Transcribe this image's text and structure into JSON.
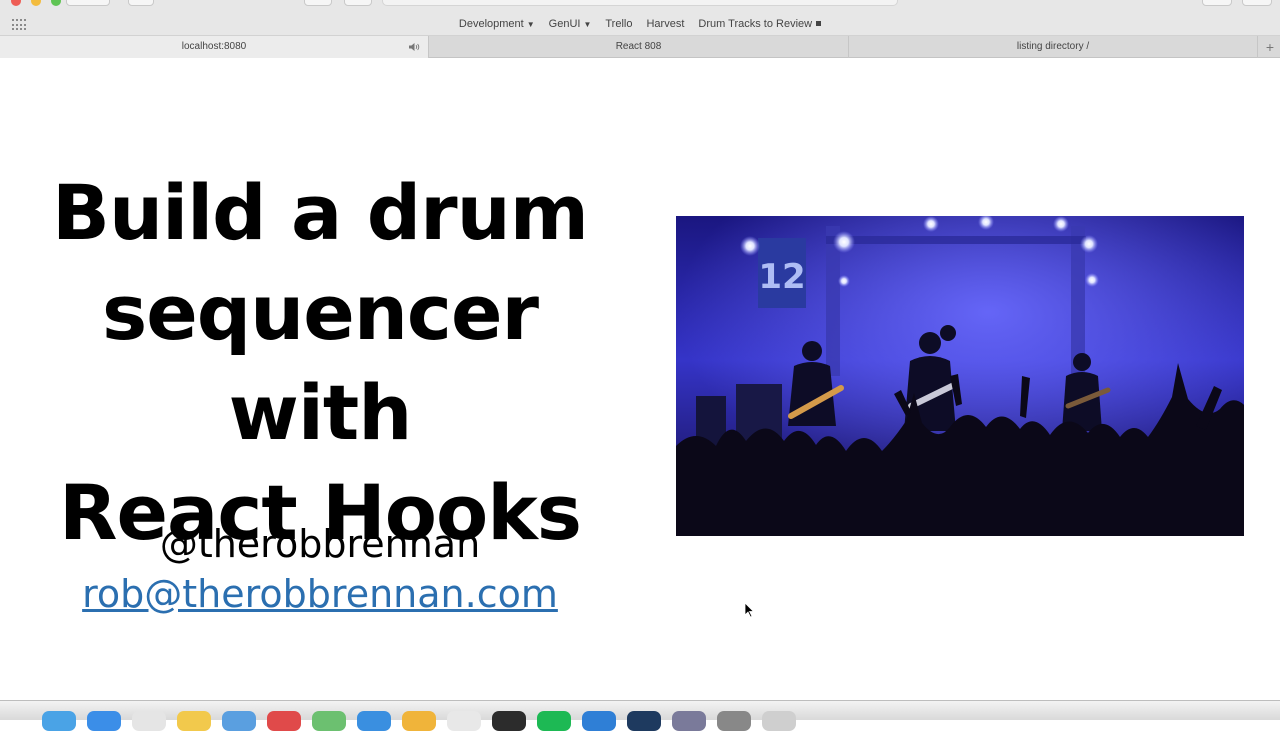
{
  "browser": {
    "url": "localhost",
    "favorites": [
      {
        "label": "Development",
        "dropdown": true
      },
      {
        "label": "GenUI",
        "dropdown": true
      },
      {
        "label": "Trello",
        "dropdown": false
      },
      {
        "label": "Harvest",
        "dropdown": false
      },
      {
        "label": "Drum Tracks to Review",
        "dropdown": false
      }
    ],
    "tabs": [
      {
        "label": "localhost:8080",
        "audio": true,
        "active": true
      },
      {
        "label": "React 808",
        "audio": false,
        "active": false
      },
      {
        "label": "listing directory /",
        "audio": false,
        "active": false
      }
    ]
  },
  "slide": {
    "title_line1": "Build a drum",
    "title_line2": "sequencer with",
    "title_line3": "React Hooks",
    "handle": "@therobbrennan",
    "email": "rob@therobbrennan.com",
    "banner_number": "12",
    "link_color": "#2b6fb0"
  },
  "dock": {
    "icons": [
      "finder-icon",
      "safari-icon",
      "calendar-icon",
      "notes-icon",
      "mail-icon",
      "news-icon",
      "maps-icon",
      "app-store-icon",
      "chrome-icon",
      "slack-icon",
      "terminal-icon",
      "spotify-icon",
      "vscode-icon",
      "photoshop-icon",
      "preview-icon",
      "system-preferences-icon",
      "trash-icon"
    ]
  }
}
